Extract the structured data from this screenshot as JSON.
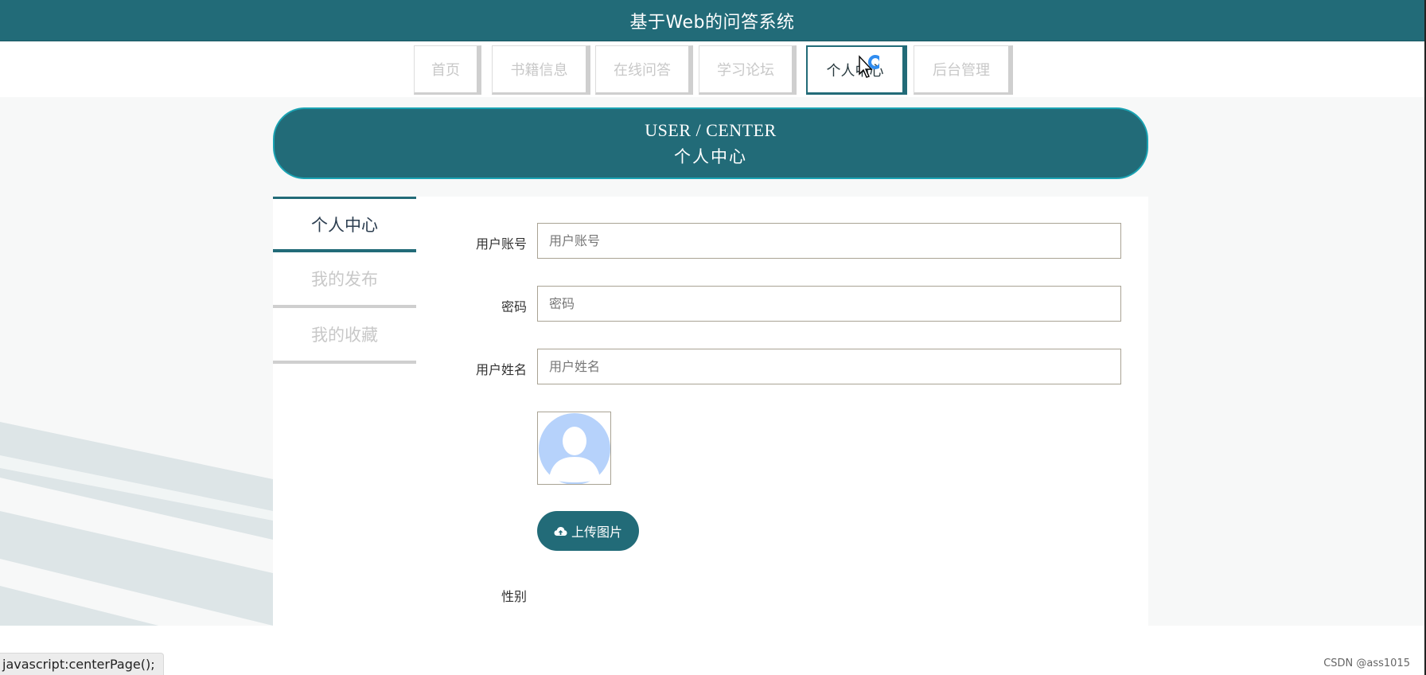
{
  "header": {
    "title": "基于Web的问答系统"
  },
  "nav": {
    "items": [
      {
        "label": "首页"
      },
      {
        "label": "书籍信息"
      },
      {
        "label": "在线问答"
      },
      {
        "label": "学习论坛"
      },
      {
        "label": "个人中心",
        "active": true
      },
      {
        "label": "后台管理"
      }
    ]
  },
  "banner": {
    "en": "USER / CENTER",
    "cn": "个人中心"
  },
  "sidebar": {
    "items": [
      {
        "label": "个人中心",
        "active": true
      },
      {
        "label": "我的发布"
      },
      {
        "label": "我的收藏"
      }
    ]
  },
  "form": {
    "username": {
      "label": "用户账号",
      "placeholder": "用户账号",
      "value": ""
    },
    "password": {
      "label": "密码",
      "placeholder": "密码",
      "value": ""
    },
    "realname": {
      "label": "用户姓名",
      "placeholder": "用户姓名",
      "value": ""
    },
    "upload_label": "上传图片",
    "gender_label": "性别"
  },
  "statusbar": {
    "text": "javascript:centerPage();"
  },
  "watermark": "CSDN @ass1015",
  "colors": {
    "primary": "#226b78",
    "accent_border": "#1aa3b3",
    "inactive_text": "#c8c8c8"
  },
  "icons": {
    "upload": "cloud-upload-icon",
    "avatar": "default-avatar-icon",
    "cursor": "pointer-cursor-icon"
  }
}
